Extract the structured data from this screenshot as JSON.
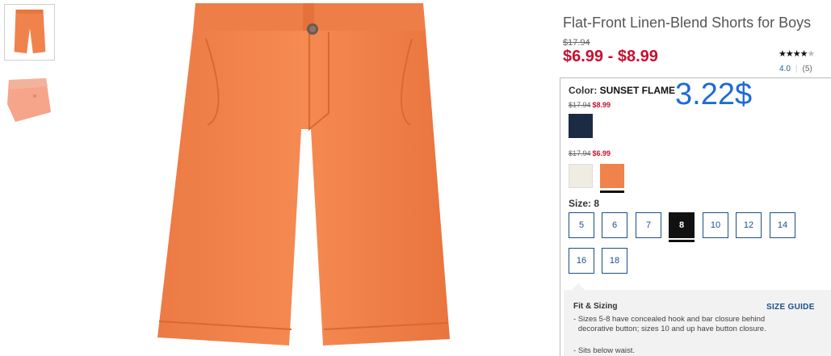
{
  "product": {
    "title": "Flat-Front Linen-Blend Shorts for Boys",
    "original_price": "$17.94",
    "price_range": "$6.99 - $8.99",
    "rating": "4.0",
    "review_count": "(5)",
    "stars_filled": "★★★★",
    "stars_empty": "★"
  },
  "overlay_price": "3.22$",
  "color": {
    "label": "Color:",
    "value": "SUNSET FLAME",
    "groups": [
      {
        "old_price": "$17.94",
        "new_price": "$8.99",
        "swatches": [
          "navy"
        ]
      },
      {
        "old_price": "$17.94",
        "new_price": "$6.99",
        "swatches": [
          "white",
          "orange"
        ]
      }
    ],
    "selected": "orange"
  },
  "size": {
    "label": "Size:",
    "value": "8",
    "options": [
      "5",
      "6",
      "7",
      "8",
      "10",
      "12",
      "14",
      "16",
      "18"
    ],
    "selected": "8"
  },
  "fit": {
    "title": "Fit & Sizing",
    "size_guide": "SIZE GUIDE",
    "bullets": [
      "Sizes 5-8 have concealed hook and bar closure behind decorative button; sizes 10 and up have button closure.",
      "Sits below waist."
    ]
  },
  "colors": {
    "accent_red": "#c8102e",
    "link_blue": "#1a4f8a",
    "overlay_blue": "#1e6bd6",
    "shorts_orange": "#f0834b",
    "navy_swatch": "#1c2b44",
    "white_swatch": "#efece4"
  }
}
